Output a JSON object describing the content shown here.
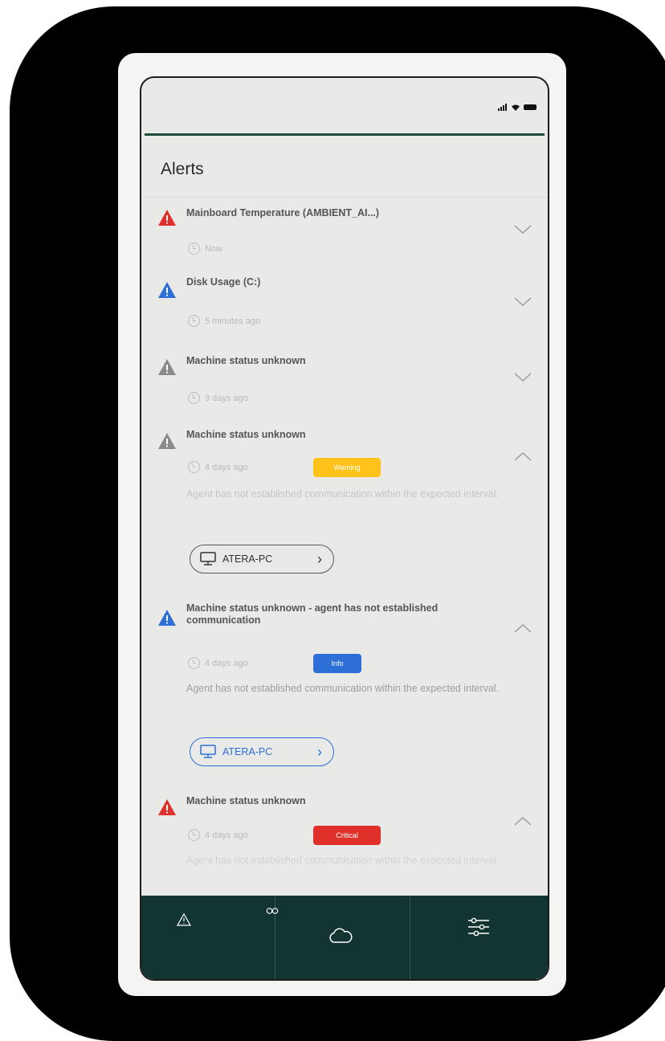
{
  "header": {
    "title": "Alerts"
  },
  "colors": {
    "critical": "#e0302a",
    "info": "#2d6fd6",
    "unknown": "#8a8a8a",
    "warning": "#ffc21a",
    "nav_bg": "#133532"
  },
  "alerts": [
    {
      "title": "Mainboard Temperature (AMBIENT_AI...)",
      "time": "Now",
      "severity": "critical",
      "expanded": false
    },
    {
      "title": "Disk Usage (C:)",
      "time": "5 minutes ago",
      "severity": "info",
      "expanded": false
    },
    {
      "title": "Machine status unknown",
      "time": "3 days ago",
      "severity": "unknown",
      "expanded": false
    },
    {
      "title": "Machine status unknown",
      "time": "4 days ago",
      "severity": "unknown",
      "expanded": true,
      "badge": "Warning",
      "description": "Agent has not established communication within the expected interval.",
      "device": "ATERA-PC"
    },
    {
      "title": "Machine status unknown - agent has not established communication",
      "time": "4 days ago",
      "severity": "info",
      "expanded": true,
      "badge": "Info",
      "description": "Agent has not established communication within the expected interval.",
      "device": "ATERA-PC"
    },
    {
      "title": "Machine status unknown",
      "time": "4 days ago",
      "severity": "critical",
      "expanded": true,
      "badge": "Critical",
      "description": "Agent has not established communication within the expected interval."
    }
  ],
  "nav": {
    "items": [
      {
        "icon": "alert-triangle-icon"
      },
      {
        "icon": "infinity-icon"
      },
      {
        "icon": "cloud-icon"
      },
      {
        "icon": "sliders-icon"
      }
    ]
  }
}
